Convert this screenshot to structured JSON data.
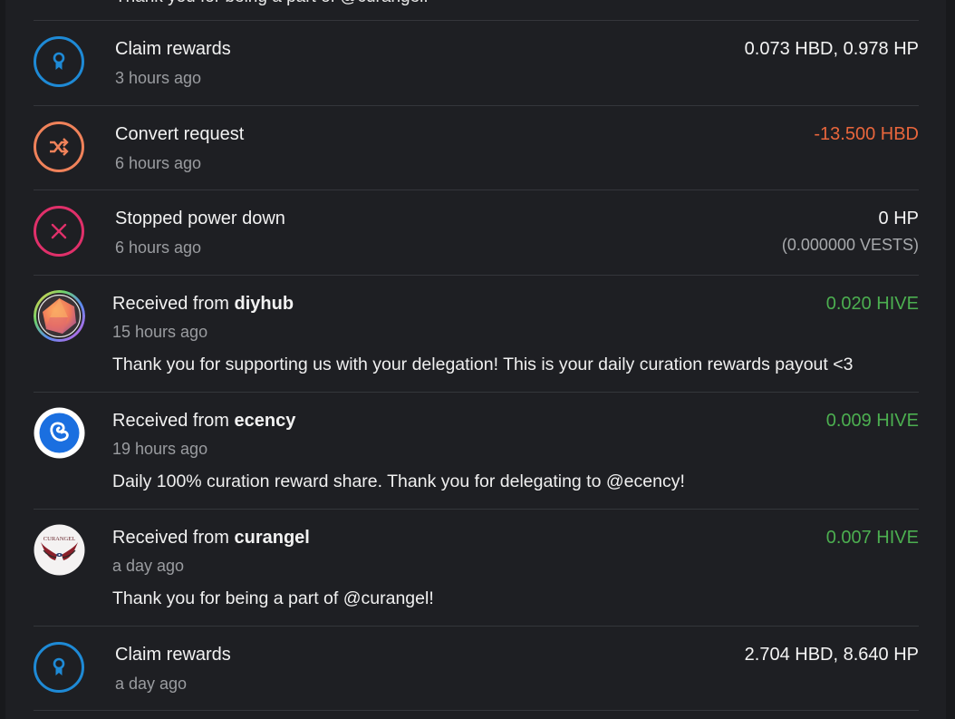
{
  "cut_off_text": "Thank you for being a part of @curangel!",
  "colors": {
    "claim": "#1e8ad6",
    "convert": "#f0825a",
    "stopped": "#e0306a",
    "incoming": "#4caf50",
    "outgoing": "#e9663c"
  },
  "transactions": [
    {
      "type": "claim",
      "icon": "award-icon",
      "title": "Claim rewards",
      "time": "3 hours ago",
      "amount": "0.073 HBD, 0.978 HP"
    },
    {
      "type": "convert",
      "icon": "shuffle-icon",
      "title": "Convert request",
      "time": "6 hours ago",
      "amount": "-13.500 HBD"
    },
    {
      "type": "stopped",
      "icon": "close-icon",
      "title": "Stopped power down",
      "time": "6 hours ago",
      "amount": "0 HP",
      "sub_amount": "(0.000000 VESTS)"
    },
    {
      "type": "transfer",
      "icon": "diyhub-avatar",
      "title_prefix": "Received from ",
      "from": "diyhub",
      "time": "15 hours ago",
      "amount": "0.020 HIVE",
      "memo": "Thank you for supporting us with your delegation! This is your daily curation rewards payout <3"
    },
    {
      "type": "transfer",
      "icon": "ecency-avatar",
      "title_prefix": "Received from ",
      "from": "ecency",
      "time": "19 hours ago",
      "amount": "0.009 HIVE",
      "memo": "Daily 100% curation reward share. Thank you for delegating to @ecency!"
    },
    {
      "type": "transfer",
      "icon": "curangel-avatar",
      "title_prefix": "Received from ",
      "from": "curangel",
      "avatar_text": "CURANGEL",
      "time": "a day ago",
      "amount": "0.007 HIVE",
      "memo": "Thank you for being a part of @curangel!"
    },
    {
      "type": "claim",
      "icon": "award-icon",
      "title": "Claim rewards",
      "time": "a day ago",
      "amount": "2.704 HBD, 8.640 HP"
    }
  ]
}
